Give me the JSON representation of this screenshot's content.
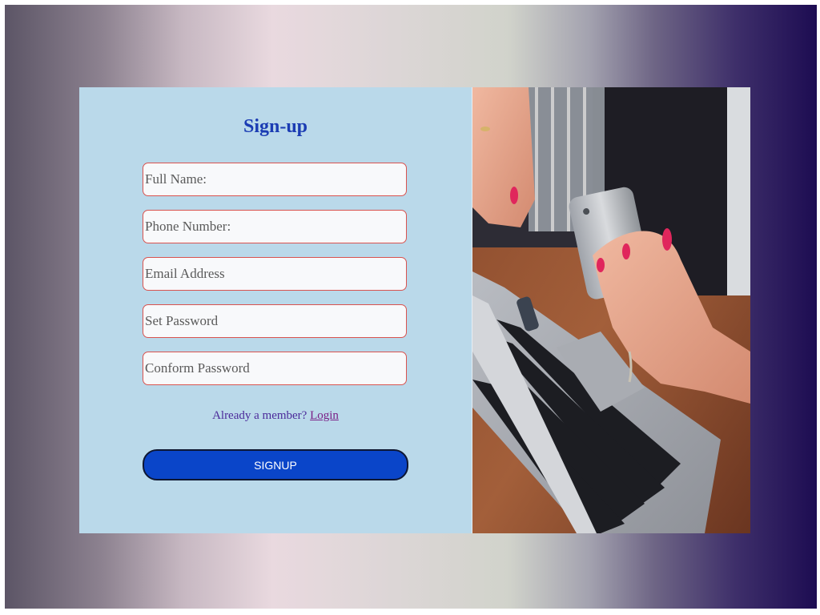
{
  "form": {
    "title": "Sign-up",
    "fields": [
      {
        "placeholder": "Full Name:"
      },
      {
        "placeholder": "Phone Number:"
      },
      {
        "placeholder": "Email Address"
      },
      {
        "placeholder": "Set Password"
      },
      {
        "placeholder": "Conform Password"
      }
    ],
    "member_text": "Already a member?",
    "login_link": "Login",
    "submit_label": "SIGNUP"
  },
  "colors": {
    "form_bg": "#bad9ea",
    "title": "#1b3cb3",
    "field_border": "#d9534f",
    "button_bg": "#0a45c9",
    "link": "#7a1f86"
  },
  "image": {
    "icon": "laptop-phone-photo"
  }
}
